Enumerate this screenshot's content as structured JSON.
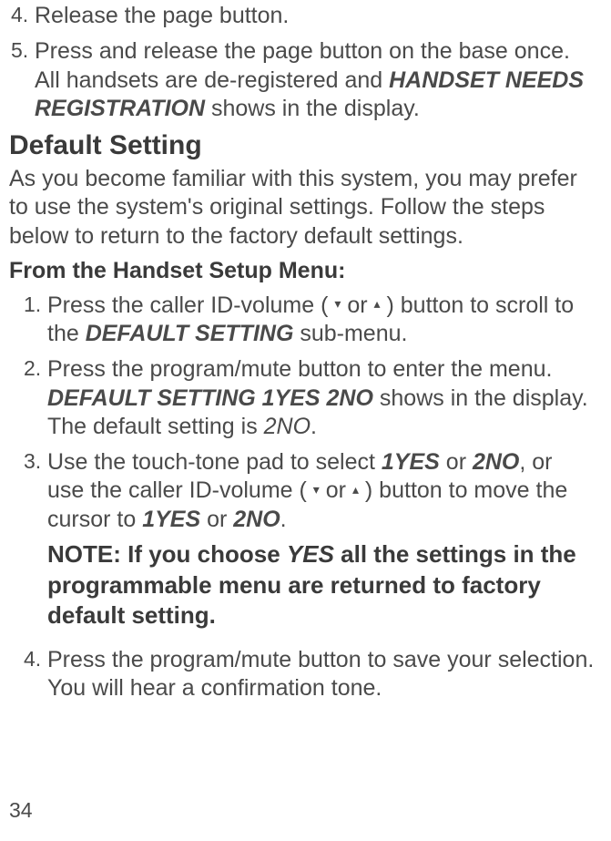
{
  "step4": {
    "num": "4.",
    "text": "Release the page button."
  },
  "step5": {
    "num": "5.",
    "textA": "Press and release the page button on the base once. All handsets are de-registered and ",
    "term": "HANDSET NEEDS REGISTRATION",
    "textB": " shows in the display."
  },
  "heading1": "Default Setting",
  "para1": "As you become familiar with this system, you may prefer to use the system's original settings. Follow the steps below to return to the factory default settings.",
  "subheading1": "From the Handset Setup Menu:",
  "ds_step1": {
    "num": "1.",
    "textA": "Press the caller ID-volume ( ",
    "arrowDown": "▾",
    "textMid": " or ",
    "arrowUp": "▴",
    "textB": " ) button to scroll to the ",
    "term": "DEFAULT SETTING",
    "textC": " sub-menu."
  },
  "ds_step2": {
    "num": "2.",
    "textA": "Press the program/mute button to enter the menu. ",
    "term": "DEFAULT SETTING 1YES 2NO",
    "textB": " shows in the display. The default setting is ",
    "italicTerm": "2NO",
    "textC": "."
  },
  "ds_step3": {
    "num": "3.",
    "textA": "Use the touch-tone pad to select ",
    "term1": "1YES",
    "textOr1": " or ",
    "term2": "2NO",
    "textB": ", or use the caller ID-volume ( ",
    "arrowDown": "▾",
    "textMid": " or ",
    "arrowUp": "▴",
    "textC": " ) button to move the cursor to ",
    "term3": "1YES",
    "textOr2": " or ",
    "term4": "2NO",
    "textD": "."
  },
  "note": {
    "textA": "NOTE: If you choose ",
    "yes": "YES",
    "textB": " all the settings in the programmable menu are returned to factory default setting."
  },
  "ds_step4": {
    "num": "4.",
    "text": "Press the program/mute button to save your selection. You will hear a confirmation tone."
  },
  "pageNumber": "34"
}
